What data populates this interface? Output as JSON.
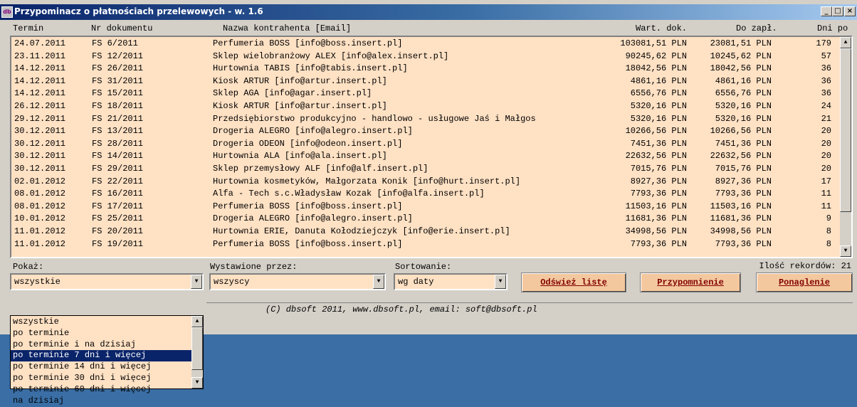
{
  "window": {
    "title": "Przypominacz o płatnościach przelewowych - w. 1.6",
    "icon": "db-app-icon"
  },
  "controls": {
    "minimize": "_",
    "maximize": "□",
    "close": "×"
  },
  "columns": [
    "Termin",
    "Nr dokumentu",
    "Nazwa kontrahenta [Email]",
    "Wart. dok.",
    "Do zapł.",
    "Dni po"
  ],
  "rows": [
    {
      "date": "24.07.2011",
      "doc": "FS 6/2011",
      "name": "Perfumeria BOSS [info@boss.insert.pl]",
      "value": "103081,51 PLN",
      "due": "23081,51 PLN",
      "days": "179"
    },
    {
      "date": "23.11.2011",
      "doc": "FS 12/2011",
      "name": "Sklep wielobranżowy  ALEX [info@alex.insert.pl]",
      "value": "90245,62 PLN",
      "due": "10245,62 PLN",
      "days": "57"
    },
    {
      "date": "14.12.2011",
      "doc": "FS 26/2011",
      "name": "Hurtownia TABIS [info@tabis.insert.pl]",
      "value": "18042,56 PLN",
      "due": "18042,56 PLN",
      "days": "36"
    },
    {
      "date": "14.12.2011",
      "doc": "FS 31/2011",
      "name": "Kiosk ARTUR [info@artur.insert.pl]",
      "value": "4861,16 PLN",
      "due": "4861,16 PLN",
      "days": "36"
    },
    {
      "date": "14.12.2011",
      "doc": "FS 15/2011",
      "name": "Sklep AGA [info@agar.insert.pl]",
      "value": "6556,76 PLN",
      "due": "6556,76 PLN",
      "days": "36"
    },
    {
      "date": "26.12.2011",
      "doc": "FS 18/2011",
      "name": "Kiosk ARTUR [info@artur.insert.pl]",
      "value": "5320,16 PLN",
      "due": "5320,16 PLN",
      "days": "24"
    },
    {
      "date": "29.12.2011",
      "doc": "FS 21/2011",
      "name": "Przedsiębiorstwo produkcyjno - handlowo - usługowe Jaś i Małgos",
      "value": "5320,16 PLN",
      "due": "5320,16 PLN",
      "days": "21"
    },
    {
      "date": "30.12.2011",
      "doc": "FS 13/2011",
      "name": "Drogeria ALEGRO [info@alegro.insert.pl]",
      "value": "10266,56 PLN",
      "due": "10266,56 PLN",
      "days": "20"
    },
    {
      "date": "30.12.2011",
      "doc": "FS 28/2011",
      "name": "Drogeria ODEON [info@odeon.insert.pl]",
      "value": "7451,36 PLN",
      "due": "7451,36 PLN",
      "days": "20"
    },
    {
      "date": "30.12.2011",
      "doc": "FS 14/2011",
      "name": "Hurtownia ALA [info@ala.insert.pl]",
      "value": "22632,56 PLN",
      "due": "22632,56 PLN",
      "days": "20"
    },
    {
      "date": "30.12.2011",
      "doc": "FS 29/2011",
      "name": "Sklep przemysłowy ALF [info@alf.insert.pl]",
      "value": "7015,76 PLN",
      "due": "7015,76 PLN",
      "days": "20"
    },
    {
      "date": "02.01.2012",
      "doc": "FS 22/2011",
      "name": "Hurtownia kosmetyków, Małgorzata Konik [info@hurt.insert.pl]",
      "value": "8927,36 PLN",
      "due": "8927,36 PLN",
      "days": "17"
    },
    {
      "date": "08.01.2012",
      "doc": "FS 16/2011",
      "name": "Alfa - Tech s.c.Władysław Kozak [info@alfa.insert.pl]",
      "value": "7793,36 PLN",
      "due": "7793,36 PLN",
      "days": "11"
    },
    {
      "date": "08.01.2012",
      "doc": "FS 17/2011",
      "name": "Perfumeria BOSS [info@boss.insert.pl]",
      "value": "11503,16 PLN",
      "due": "11503,16 PLN",
      "days": "11"
    },
    {
      "date": "10.01.2012",
      "doc": "FS 25/2011",
      "name": "Drogeria ALEGRO [info@alegro.insert.pl]",
      "value": "11681,36 PLN",
      "due": "11681,36 PLN",
      "days": "9"
    },
    {
      "date": "11.01.2012",
      "doc": "FS 20/2011",
      "name": "Hurtownia ERIE, Danuta Kołodziejczyk [info@erie.insert.pl]",
      "value": "34998,56 PLN",
      "due": "34998,56 PLN",
      "days": "8"
    },
    {
      "date": "11.01.2012",
      "doc": "FS 19/2011",
      "name": "Perfumeria BOSS [info@boss.insert.pl]",
      "value": "7793,36 PLN",
      "due": "7793,36 PLN",
      "days": "8"
    }
  ],
  "filters": {
    "show_label": "Pokaż:",
    "show_value": "wszystkie",
    "issued_label": "Wystawione przez:",
    "issued_value": "wszyscy",
    "sort_label": "Sortowanie:",
    "sort_value": "wg daty"
  },
  "buttons": {
    "refresh": "Odśwież listę",
    "reminder": "Przypomnienie",
    "dunning": "Ponaglenie"
  },
  "record_count": "Ilość rekordów: 21",
  "footer": "(C) dbsoft 2011, www.dbsoft.pl, email: soft@dbsoft.pl",
  "dropdown": {
    "items": [
      "wszystkie",
      "po terminie",
      "po terminie i na dzisiaj",
      "po terminie 7 dni i więcej",
      "po terminie 14 dni i więcej",
      "po terminie 30 dni i więcej",
      "po terminie 60 dni i więcej",
      "na dzisiaj"
    ],
    "selected_index": 3
  },
  "colors": {
    "list_bg": "#ffe1c4",
    "button_bg": "#f4c89e",
    "button_text": "#800000",
    "desktop": "#3a6ea5",
    "selection": "#0a246a"
  }
}
